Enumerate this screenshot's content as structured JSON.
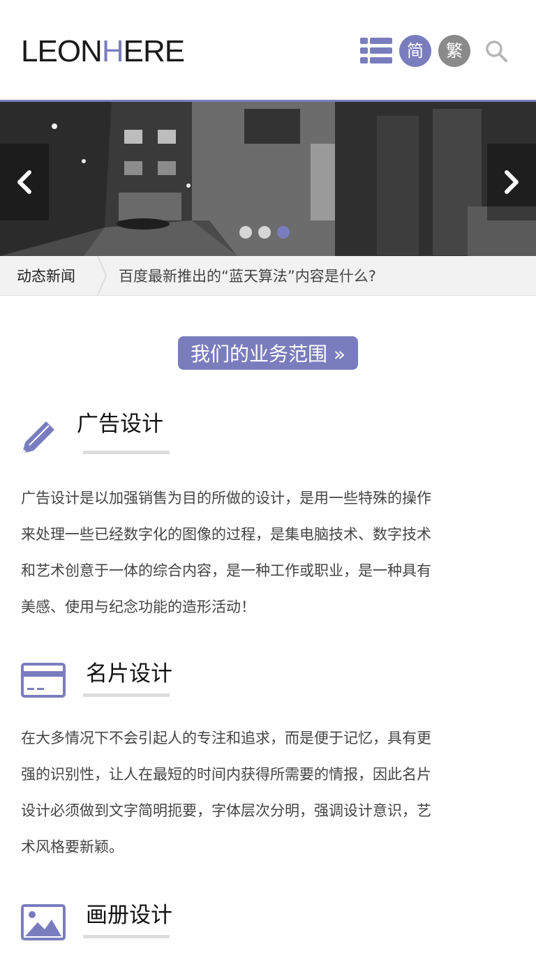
{
  "header": {
    "logo_part1": "LEON",
    "logo_accent": "H",
    "logo_part2": "ERE",
    "menu_icon": "list-menu-icon",
    "lang_simplified": "简",
    "lang_traditional": "繁",
    "search_icon": "search-icon",
    "accent_color": "#7a7dbd"
  },
  "banner": {
    "prev_icon": "chevron-left-icon",
    "next_icon": "chevron-right-icon",
    "active_slide_index": 3,
    "slide_count": 3
  },
  "news": {
    "label": "动态新闻",
    "headline": "百度最新推出的“蓝天算法”内容是什么?"
  },
  "scope": {
    "button_label": "我们的业务范围 »"
  },
  "services": [
    {
      "icon": "pencil-icon",
      "title": "广告设计",
      "description": "广告设计是以加强销售为目的所做的设计，是用一些特殊的操作来处理一些已经数字化的图像的过程，是集电脑技术、数字技术和艺术创意于一体的综合内容，是一种工作或职业，是一种具有美感、使用与纪念功能的造形活动！"
    },
    {
      "icon": "card-icon",
      "title": "名片设计",
      "description": "在大多情况下不会引起人的专注和追求，而是便于记忆，具有更强的识别性，让人在最短的时间内获得所需要的情报，因此名片设计必须做到文字简明扼要，字体层次分明，强调设计意识，艺术风格要新颖。"
    },
    {
      "icon": "image-icon",
      "title": "画册设计"
    }
  ]
}
